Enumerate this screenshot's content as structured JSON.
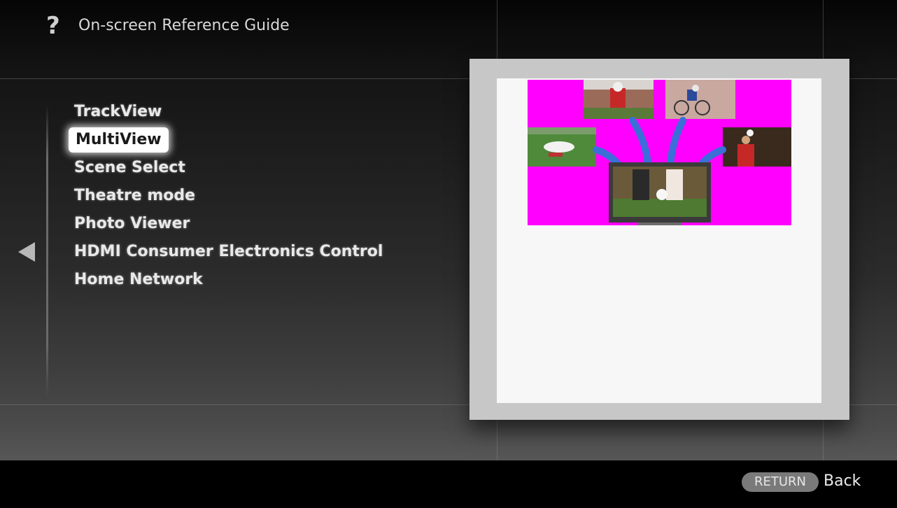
{
  "header": {
    "help_icon": "question-mark-icon",
    "title": "On-screen Reference Guide"
  },
  "navigation": {
    "back_arrow_icon": "left-arrow-icon"
  },
  "menu": {
    "items": [
      {
        "label": "TrackView",
        "selected": false
      },
      {
        "label": "MultiView",
        "selected": true
      },
      {
        "label": "Scene Select",
        "selected": false
      },
      {
        "label": "Theatre mode",
        "selected": false
      },
      {
        "label": "Photo Viewer",
        "selected": false
      },
      {
        "label": "HDMI Consumer Electronics Control",
        "selected": false
      },
      {
        "label": "Home Network",
        "selected": false
      }
    ]
  },
  "preview": {
    "illustration": "multiview-sports-thumbnails-illustration",
    "background_color": "#ff00ff",
    "arrow_color": "#3a6fd8"
  },
  "footer": {
    "return_button_label": "RETURN",
    "back_label": "Back"
  }
}
